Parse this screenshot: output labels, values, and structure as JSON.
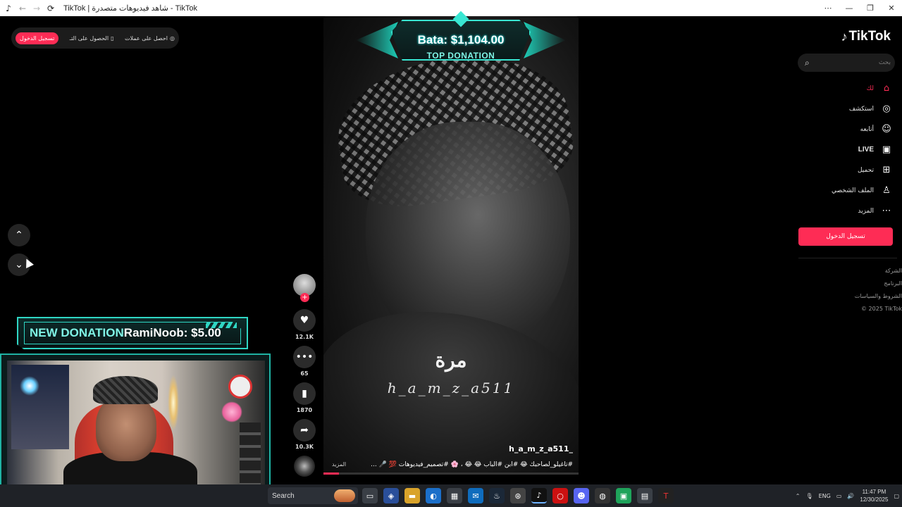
{
  "window": {
    "title": "TikTok | شاهد فيديوهات متصدرة - TikTok",
    "controls": [
      "more-icon",
      "minimize-icon",
      "maximize-icon",
      "close-icon"
    ]
  },
  "top_pill": {
    "login": "تسجيل الدخول",
    "get_app": "الحصول على التـ",
    "get_coins": "احصل على عملات"
  },
  "overlay_top_donation": {
    "name_amount": "Bata: $1,104.00",
    "label": "TOP DONATION"
  },
  "overlay_new_donation": {
    "label": "NEW DONATION",
    "name_amount": "RamiNoob: $5.00"
  },
  "video": {
    "caption_ar": "مرة",
    "caption_handle": "h_a_m_z_a511",
    "author": "h_a_m_z_a511_",
    "description": "#تاغيلو_لصاحبك 😂 #ابن #الباب 😂 😂 ، 🌸 #تصميم_فيديوهات 💯 🎤 ...",
    "more_label": "المزيد",
    "progress": 0.06
  },
  "actions": {
    "likes": "12.1K",
    "comments": "65",
    "bookmarks": "1870",
    "shares": "10.3K"
  },
  "sidebar": {
    "brand": "TikTok",
    "search_placeholder": "بحث",
    "nav": [
      {
        "label": "لك",
        "icon": "home-icon",
        "active": true
      },
      {
        "label": "استكشف",
        "icon": "compass-icon",
        "active": false
      },
      {
        "label": "أتابعه",
        "icon": "user-follow-icon",
        "active": false
      },
      {
        "label": "LIVE",
        "icon": "live-icon",
        "active": false
      },
      {
        "label": "تحميل",
        "icon": "upload-icon",
        "active": false
      },
      {
        "label": "الملف الشخصي",
        "icon": "profile-icon",
        "active": false
      },
      {
        "label": "المزيد",
        "icon": "more-dots-icon",
        "active": false
      }
    ],
    "login_button": "تسجيل الدخول",
    "footer": [
      "الشركة",
      "البرنامج",
      "الشروط والسياسات",
      "© 2025 TikTok"
    ]
  },
  "taskbar": {
    "search_label": "Search",
    "language": "ENG",
    "time": "11:47 PM",
    "date": "12/30/2025"
  },
  "colors": {
    "accent": "#fe2c55",
    "overlay_teal": "#39e6d2"
  }
}
